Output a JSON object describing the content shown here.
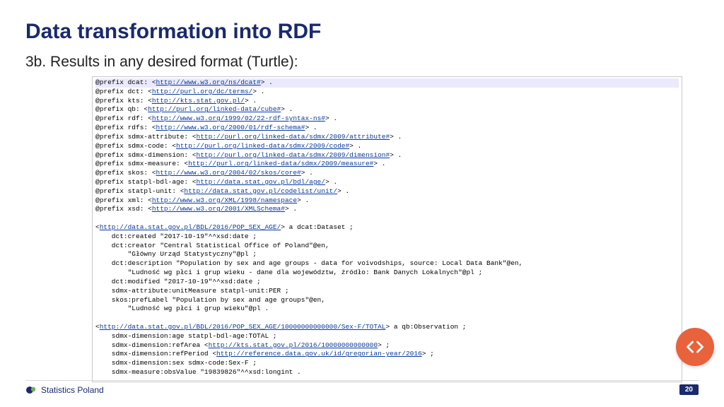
{
  "title": "Data transformation into RDF",
  "subtitle": "3b. Results in any desired format (Turtle):",
  "prefixes": [
    {
      "name": "dcat",
      "url": "http://www.w3.org/ns/dcat#"
    },
    {
      "name": "dct",
      "url": "http://purl.org/dc/terms/"
    },
    {
      "name": "kts",
      "url": "http://kts.stat.gov.pl/"
    },
    {
      "name": "qb",
      "url": "http://purl.org/linked-data/cube#"
    },
    {
      "name": "rdf",
      "url": "http://www.w3.org/1999/02/22-rdf-syntax-ns#"
    },
    {
      "name": "rdfs",
      "url": "http://www.w3.org/2000/01/rdf-schema#"
    },
    {
      "name": "sdmx-attribute",
      "url": "http://purl.org/linked-data/sdmx/2009/attribute#"
    },
    {
      "name": "sdmx-code",
      "url": "http://purl.org/linked-data/sdmx/2009/code#"
    },
    {
      "name": "sdmx-dimension",
      "url": "http://purl.org/linked-data/sdmx/2009/dimension#"
    },
    {
      "name": "sdmx-measure",
      "url": "http://purl.org/linked-data/sdmx/2009/measure#"
    },
    {
      "name": "skos",
      "url": "http://www.w3.org/2004/02/skos/core#"
    },
    {
      "name": "statpl-bdl-age",
      "url": "http://data.stat.gov.pl/bdl/age/"
    },
    {
      "name": "statpl-unit",
      "url": "http://data.stat.gov.pl/codelist/unit/"
    },
    {
      "name": "xml",
      "url": "http://www.w3.org/XML/1998/namespace"
    },
    {
      "name": "xsd",
      "url": "http://www.w3.org/2001/XMLSchema#"
    }
  ],
  "dataset": {
    "subject_url": "http://data.stat.gov.pl/BDL/2016/POP_SEX_AGE/",
    "subject_tail": " a dcat:Dataset ;",
    "lines": [
      "    dct:created \"2017-10-19\"^^xsd:date ;",
      "    dct:creator \"Central Statistical Office of Poland\"@en,",
      "        \"Główny Urząd Statystyczny\"@pl ;",
      "    dct:description \"Population by sex and age groups - data for voivodships, source: Local Data Bank\"@en,",
      "        \"Ludność wg płci i grup wieku - dane dla województw, źródło: Bank Danych Lokalnych\"@pl ;",
      "    dct:modified \"2017-10-19\"^^xsd:date ;",
      "    sdmx-attribute:unitMeasure statpl-unit:PER ;",
      "    skos:prefLabel \"Population by sex and age groups\"@en,",
      "        \"Ludność wg płci i grup wieku\"@pl ."
    ]
  },
  "observation": {
    "subject_url": "http://data.stat.gov.pl/BDL/2016/POP_SEX_AGE/10000000000000/Sex-F/TOTAL",
    "subject_tail": " a qb:Observation ;",
    "lines_before_ref": [
      "    sdmx-dimension:age statpl-bdl-age:TOTAL ;"
    ],
    "refArea_label": "    sdmx-dimension:refArea <",
    "refArea_url": "http://kts.stat.gov.pl/2016/10000000000000",
    "refArea_tail": "> ;",
    "refPeriod_label": "    sdmx-dimension:refPeriod <",
    "refPeriod_url": "http://reference.data.gov.uk/id/gregorian-year/2016",
    "refPeriod_tail": "> ;",
    "lines_after_ref": [
      "    sdmx-dimension:sex sdmx-code:Sex-F ;",
      "    sdmx-measure:obsValue \"19839826\"^^xsd:longint ."
    ]
  },
  "footer": {
    "brand": "Statistics Poland",
    "page": "20"
  },
  "colors": {
    "accent": "#1a2a6c",
    "icon_bg": "#e8623c",
    "link": "#0a3a9c"
  }
}
